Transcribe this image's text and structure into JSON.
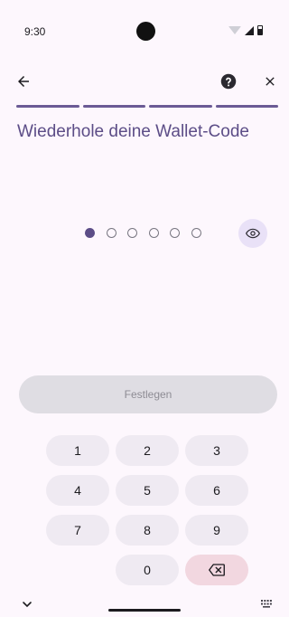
{
  "status_bar": {
    "time": "9:30",
    "icons": [
      "wifi-icon",
      "signal-icon",
      "battery-icon"
    ]
  },
  "top_bar": {
    "back_icon": "arrow-left-icon",
    "help_icon": "help-circle-icon",
    "close_icon": "close-icon"
  },
  "progress": {
    "segments": 4,
    "completed": 4
  },
  "title": "Wiederhole deine Wallet-Code",
  "pin": {
    "length": 6,
    "entered": 1,
    "toggle_icon": "eye-icon"
  },
  "submit_label": "Festlegen",
  "keypad": {
    "keys": [
      {
        "label": "1"
      },
      {
        "label": "2"
      },
      {
        "label": "3"
      },
      {
        "label": "4"
      },
      {
        "label": "5"
      },
      {
        "label": "6"
      },
      {
        "label": "7"
      },
      {
        "label": "8"
      },
      {
        "label": "9"
      },
      {
        "label": ""
      },
      {
        "label": "0"
      },
      {
        "label": "⌫",
        "icon": "backspace-icon"
      }
    ]
  },
  "nav": {
    "chevron_icon": "chevron-down-icon",
    "keyboard_icon": "keyboard-grid-icon"
  },
  "colors": {
    "accent": "#5c4d87",
    "background": "#fdf7fd",
    "key_bg": "#efeaf2",
    "backspace_bg": "#f2d7e0",
    "disabled_button": "#dfdde3"
  }
}
